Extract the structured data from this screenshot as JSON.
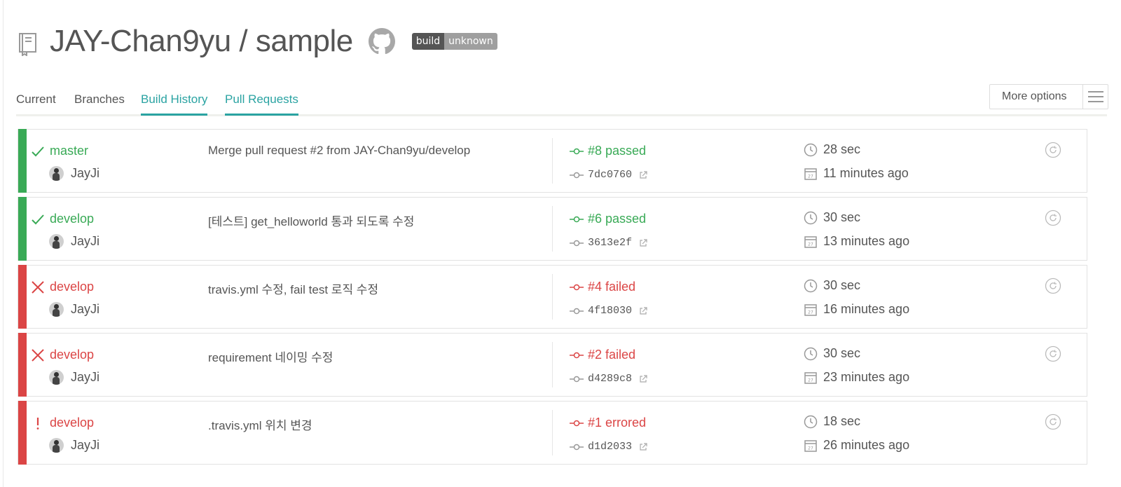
{
  "repo": {
    "owner_repo": "JAY-Chan9yu / sample"
  },
  "badge": {
    "left": "build",
    "right": "unknown"
  },
  "tabs": [
    {
      "label": "Current"
    },
    {
      "label": "Branches"
    },
    {
      "label": "Build History"
    },
    {
      "label": "Pull Requests"
    }
  ],
  "more_options": {
    "label": "More options"
  },
  "colors": {
    "passed": "#39aa56",
    "failed": "#db4545",
    "accent": "#2aa3a2"
  },
  "builds": [
    {
      "state": "passed",
      "branch": "master",
      "author": "JayJi",
      "message": "Merge pull request #2 from JAY-Chan9yu/develop",
      "build": "#8 passed",
      "commit": "7dc0760",
      "duration": "28 sec",
      "finished": "11 minutes ago"
    },
    {
      "state": "passed",
      "branch": "develop",
      "author": "JayJi",
      "message": "[테스트] get_helloworld 통과 되도록 수정",
      "build": "#6 passed",
      "commit": "3613e2f",
      "duration": "30 sec",
      "finished": "13 minutes ago"
    },
    {
      "state": "failed",
      "branch": "develop",
      "author": "JayJi",
      "message": "travis.yml 수정, fail test 로직 수정",
      "build": "#4 failed",
      "commit": "4f18030",
      "duration": "30 sec",
      "finished": "16 minutes ago"
    },
    {
      "state": "failed",
      "branch": "develop",
      "author": "JayJi",
      "message": "requirement 네이밍 수정",
      "build": "#2 failed",
      "commit": "d4289c8",
      "duration": "30 sec",
      "finished": "23 minutes ago"
    },
    {
      "state": "errored",
      "branch": "develop",
      "author": "JayJi",
      "message": ".travis.yml 위치 변경",
      "build": "#1 errored",
      "commit": "d1d2033",
      "duration": "18 sec",
      "finished": "26 minutes ago"
    }
  ]
}
